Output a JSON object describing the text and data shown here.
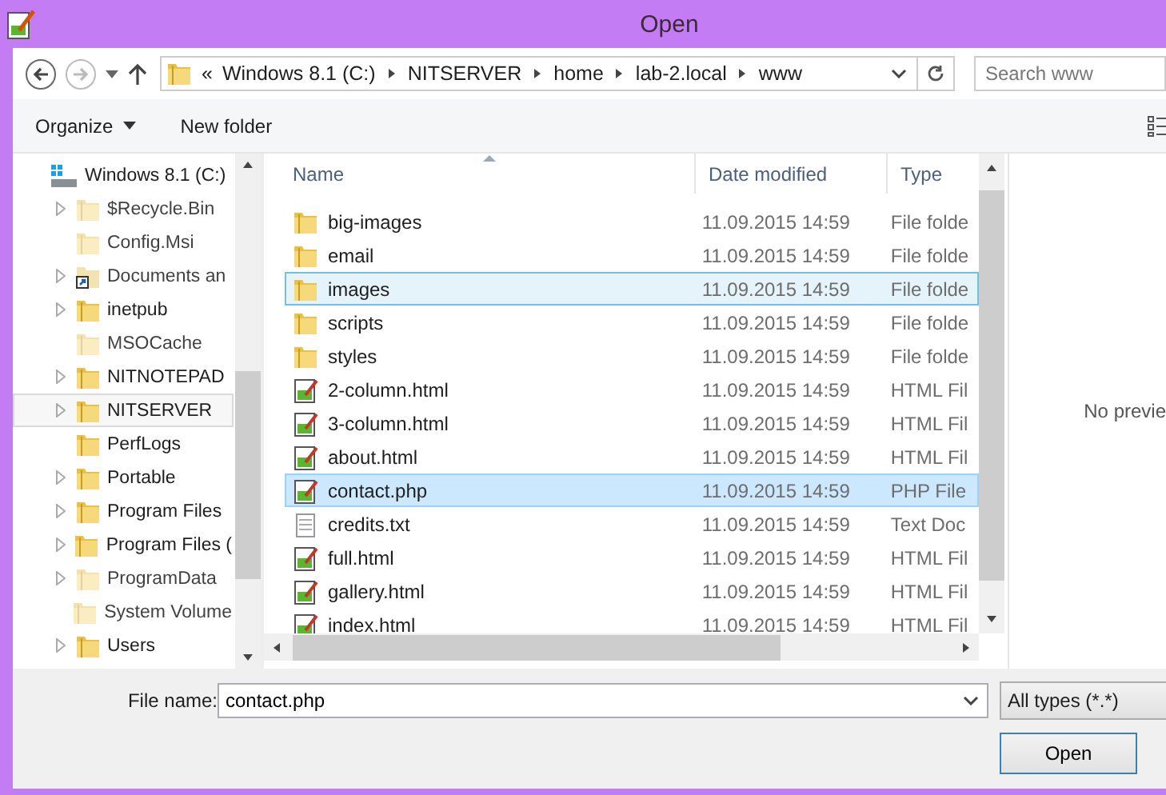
{
  "window": {
    "title": "Open"
  },
  "address_bar": {
    "overflow": "«",
    "crumbs": [
      "Windows 8.1 (C:)",
      "NITSERVER",
      "home",
      "lab-2.local",
      "www"
    ]
  },
  "search": {
    "placeholder": "Search www"
  },
  "toolbar": {
    "organize": "Organize",
    "new_folder": "New folder"
  },
  "tree": {
    "root": "Windows 8.1 (C:)",
    "items": [
      {
        "label": "$Recycle.Bin",
        "expandable": true,
        "hidden": true,
        "selected": false
      },
      {
        "label": "Config.Msi",
        "expandable": false,
        "hidden": true,
        "selected": false
      },
      {
        "label": "Documents an",
        "expandable": true,
        "hidden": true,
        "selected": false,
        "shortcut": true
      },
      {
        "label": "inetpub",
        "expandable": true,
        "hidden": false,
        "selected": false
      },
      {
        "label": "MSOCache",
        "expandable": false,
        "hidden": true,
        "selected": false
      },
      {
        "label": "NITNOTEPAD",
        "expandable": true,
        "hidden": false,
        "selected": false
      },
      {
        "label": "NITSERVER",
        "expandable": true,
        "hidden": false,
        "selected": true
      },
      {
        "label": "PerfLogs",
        "expandable": false,
        "hidden": false,
        "selected": false
      },
      {
        "label": "Portable",
        "expandable": true,
        "hidden": false,
        "selected": false
      },
      {
        "label": "Program Files",
        "expandable": true,
        "hidden": false,
        "selected": false
      },
      {
        "label": "Program Files (",
        "expandable": true,
        "hidden": false,
        "selected": false
      },
      {
        "label": "ProgramData",
        "expandable": true,
        "hidden": true,
        "selected": false
      },
      {
        "label": "System Volume",
        "expandable": false,
        "hidden": true,
        "selected": false
      },
      {
        "label": "Users",
        "expandable": true,
        "hidden": false,
        "selected": false
      }
    ]
  },
  "table": {
    "columns": [
      "Name",
      "Date modified",
      "Type"
    ],
    "rows": [
      {
        "kind": "folder",
        "name": "big-images",
        "date": "11.09.2015 14:59",
        "type": "File folde",
        "selected": false,
        "hot": false
      },
      {
        "kind": "folder",
        "name": "email",
        "date": "11.09.2015 14:59",
        "type": "File folde",
        "selected": false,
        "hot": false
      },
      {
        "kind": "folder",
        "name": "images",
        "date": "11.09.2015 14:59",
        "type": "File folde",
        "selected": false,
        "hot": true
      },
      {
        "kind": "folder",
        "name": "scripts",
        "date": "11.09.2015 14:59",
        "type": "File folde",
        "selected": false,
        "hot": false
      },
      {
        "kind": "folder",
        "name": "styles",
        "date": "11.09.2015 14:59",
        "type": "File folde",
        "selected": false,
        "hot": false
      },
      {
        "kind": "script",
        "name": "2-column.html",
        "date": "11.09.2015 14:59",
        "type": "HTML Fil",
        "selected": false,
        "hot": false
      },
      {
        "kind": "script",
        "name": "3-column.html",
        "date": "11.09.2015 14:59",
        "type": "HTML Fil",
        "selected": false,
        "hot": false
      },
      {
        "kind": "script",
        "name": "about.html",
        "date": "11.09.2015 14:59",
        "type": "HTML Fil",
        "selected": false,
        "hot": false
      },
      {
        "kind": "script",
        "name": "contact.php",
        "date": "11.09.2015 14:59",
        "type": "PHP File",
        "selected": true,
        "hot": false
      },
      {
        "kind": "text",
        "name": "credits.txt",
        "date": "11.09.2015 14:59",
        "type": "Text Doc",
        "selected": false,
        "hot": false
      },
      {
        "kind": "script",
        "name": "full.html",
        "date": "11.09.2015 14:59",
        "type": "HTML Fil",
        "selected": false,
        "hot": false
      },
      {
        "kind": "script",
        "name": "gallery.html",
        "date": "11.09.2015 14:59",
        "type": "HTML Fil",
        "selected": false,
        "hot": false
      },
      {
        "kind": "script",
        "name": "index.html",
        "date": "11.09.2015 14:59",
        "type": "HTML Fil",
        "selected": false,
        "hot": false
      }
    ]
  },
  "preview": {
    "message": "No previe"
  },
  "file_name": {
    "label": "File name:",
    "value": "contact.php"
  },
  "file_type": {
    "value": "All types (*.*)"
  },
  "buttons": [
    "Open"
  ]
}
